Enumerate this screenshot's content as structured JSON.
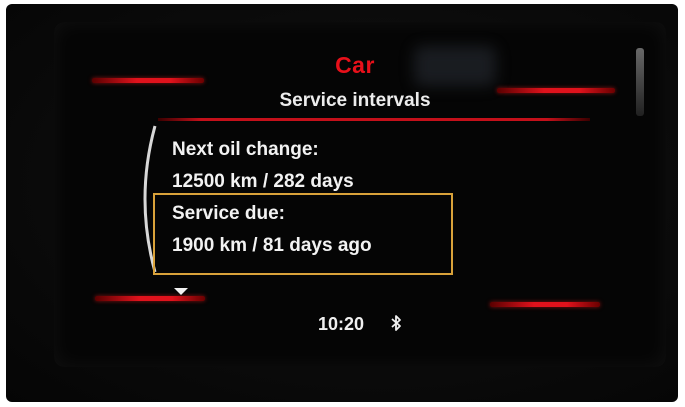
{
  "header": {
    "app_title": "Car",
    "page_title": "Service intervals"
  },
  "content": {
    "next_oil_change_label": "Next oil change:",
    "next_oil_change_value": "12500 km / 282 days",
    "service_due_label": "Service due:",
    "service_due_value": "1900 km / 81 days ago"
  },
  "status_bar": {
    "time": "10:20",
    "bluetooth_icon": "bluetooth-icon"
  },
  "colors": {
    "accent_red": "#e8101a",
    "highlight_border": "#d9a23a",
    "text": "#f2f2f2",
    "background": "#050505"
  }
}
